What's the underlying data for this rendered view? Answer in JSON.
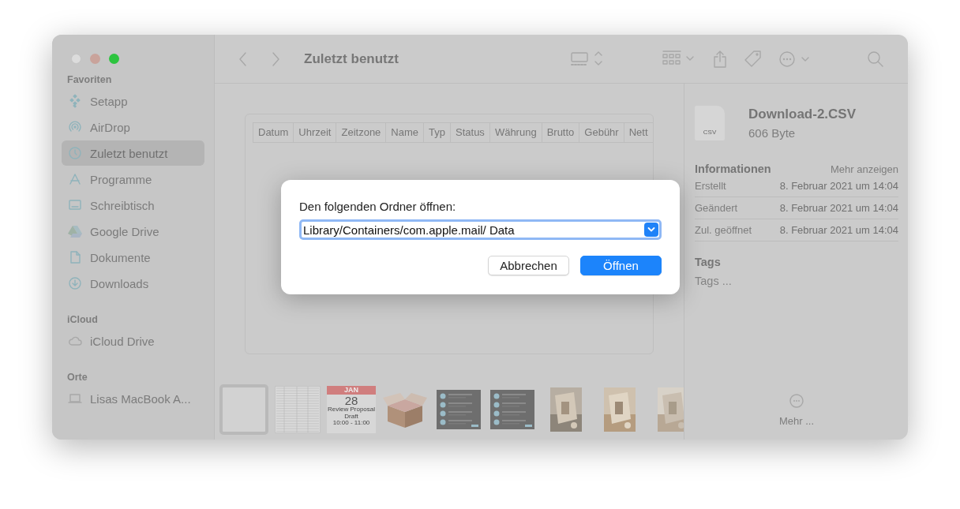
{
  "window": {
    "title": "Zuletzt benutzt"
  },
  "sidebar": {
    "sections": [
      {
        "title": "Favoriten",
        "items": [
          {
            "label": "Setapp",
            "selected": false
          },
          {
            "label": "AirDrop",
            "selected": false
          },
          {
            "label": "Zuletzt benutzt",
            "selected": true
          },
          {
            "label": "Programme",
            "selected": false
          },
          {
            "label": "Schreibtisch",
            "selected": false
          },
          {
            "label": "Google Drive",
            "selected": false
          },
          {
            "label": "Dokumente",
            "selected": false
          },
          {
            "label": "Downloads",
            "selected": false
          }
        ]
      },
      {
        "title": "iCloud",
        "items": [
          {
            "label": "iCloud Drive",
            "selected": false
          }
        ]
      },
      {
        "title": "Orte",
        "items": [
          {
            "label": "Lisas MacBook A...",
            "selected": false
          }
        ]
      }
    ]
  },
  "preview": {
    "columns": [
      "Datum",
      "Uhrzeit",
      "Zeitzone",
      "Name",
      "Typ",
      "Status",
      "Währung",
      "Brutto",
      "Gebühr",
      "Nett"
    ]
  },
  "thumbnails": [
    {
      "kind": "blank",
      "selected": true
    },
    {
      "kind": "sheet",
      "selected": false
    },
    {
      "kind": "calendar",
      "selected": false,
      "month": "JAN",
      "day": "28",
      "event": "Review Proposal Draft",
      "time": "10:00 - 11:00"
    },
    {
      "kind": "box",
      "selected": false
    },
    {
      "kind": "screenshot",
      "selected": false
    },
    {
      "kind": "screenshot",
      "selected": false
    },
    {
      "kind": "picture",
      "selected": false
    },
    {
      "kind": "picture",
      "selected": false
    },
    {
      "kind": "picture",
      "selected": false
    }
  ],
  "dialog": {
    "label": "Den folgenden Ordner öffnen:",
    "path": "Library/Containers/com.apple.mail/ Data",
    "buttons": [
      {
        "label": "Abbrechen",
        "kind": "secondary"
      },
      {
        "label": "Öffnen",
        "kind": "primary"
      }
    ]
  },
  "inspector": {
    "file_type": "CSV",
    "file_name": "Download-2.CSV",
    "file_size": "606 Byte",
    "info_title": "Informationen",
    "more_link": "Mehr anzeigen",
    "rows": [
      {
        "label": "Erstellt",
        "value": "8. Februar 2021 um 14:04"
      },
      {
        "label": "Geändert",
        "value": "8. Februar 2021 um 14:04"
      },
      {
        "label": "Zul. geöffnet",
        "value": "8. Februar 2021 um 14:04"
      }
    ],
    "tags_title": "Tags",
    "tags_placeholder": "Tags ...",
    "more_button": "Mehr ..."
  }
}
